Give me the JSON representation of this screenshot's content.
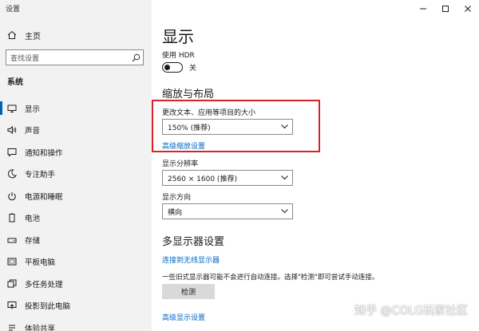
{
  "window": {
    "title": "设置"
  },
  "sidebar": {
    "home_label": "主页",
    "search_placeholder": "查找设置",
    "section_label": "系统",
    "items": [
      {
        "label": "显示",
        "icon": "monitor-icon",
        "active": true
      },
      {
        "label": "声音",
        "icon": "speaker-icon"
      },
      {
        "label": "通知和操作",
        "icon": "message-icon"
      },
      {
        "label": "专注助手",
        "icon": "moon-icon"
      },
      {
        "label": "电源和睡眠",
        "icon": "power-icon"
      },
      {
        "label": "电池",
        "icon": "battery-icon"
      },
      {
        "label": "存储",
        "icon": "storage-icon"
      },
      {
        "label": "平板电脑",
        "icon": "tablet-icon"
      },
      {
        "label": "多任务处理",
        "icon": "multitask-icon"
      },
      {
        "label": "投影到此电脑",
        "icon": "project-icon"
      },
      {
        "label": "体验共享",
        "icon": "share-icon"
      }
    ]
  },
  "main": {
    "title": "显示",
    "hdr": {
      "label": "使用 HDR",
      "state": "关"
    },
    "scale_layout": {
      "heading": "缩放与布局",
      "text_size_label": "更改文本、应用等项目的大小",
      "text_size_value": "150% (推荐)",
      "advanced_scaling_link": "高级缩放设置",
      "resolution_label": "显示分辨率",
      "resolution_value": "2560 × 1600 (推荐)",
      "orientation_label": "显示方向",
      "orientation_value": "横向"
    },
    "multi_display": {
      "heading": "多显示器设置",
      "wireless_link": "连接到无线显示器",
      "description": "一些旧式显示器可能不会进行自动连接。选择\"检测\"即可尝试手动连接。",
      "detect_button": "检测",
      "advanced_display_link": "高级显示设置"
    }
  },
  "watermark": "知乎 @COLG玩家社区",
  "colors": {
    "accent": "#0063b1",
    "link": "#0067c0",
    "highlight": "#d9232a",
    "sidebar_bg": "#f2f2f2"
  }
}
